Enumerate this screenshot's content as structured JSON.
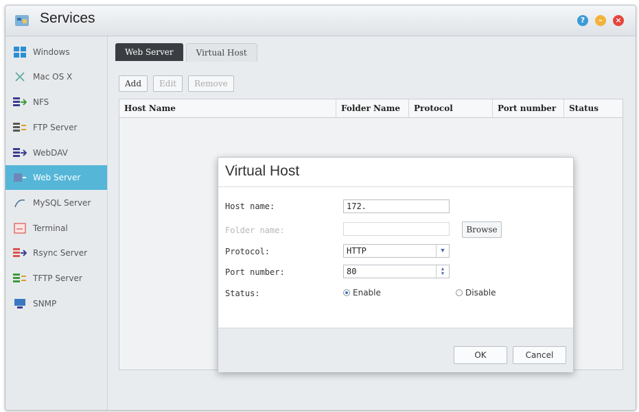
{
  "window": {
    "title": "Services"
  },
  "sidebar": {
    "items": [
      {
        "label": "Windows",
        "icon": "windows-icon"
      },
      {
        "label": "Mac OS X",
        "icon": "mac-x-icon"
      },
      {
        "label": "NFS",
        "icon": "nfs-icon"
      },
      {
        "label": "FTP Server",
        "icon": "ftp-icon"
      },
      {
        "label": "WebDAV",
        "icon": "webdav-icon"
      },
      {
        "label": "Web Server",
        "icon": "web-server-icon",
        "active": true
      },
      {
        "label": "MySQL Server",
        "icon": "mysql-icon"
      },
      {
        "label": "Terminal",
        "icon": "terminal-icon"
      },
      {
        "label": "Rsync Server",
        "icon": "rsync-icon"
      },
      {
        "label": "TFTP Server",
        "icon": "tftp-icon"
      },
      {
        "label": "SNMP",
        "icon": "snmp-icon"
      }
    ]
  },
  "tabs": [
    {
      "label": "Web Server",
      "active": true
    },
    {
      "label": "Virtual Host",
      "active": false
    }
  ],
  "toolbar": {
    "add": "Add",
    "edit": "Edit",
    "remove": "Remove"
  },
  "table": {
    "columns": [
      "Host Name",
      "Folder Name",
      "Protocol",
      "Port number",
      "Status"
    ],
    "rows": []
  },
  "dialog": {
    "title": "Virtual Host",
    "host_label": "Host name:",
    "host_value": "172.",
    "folder_label": "Folder name:",
    "folder_value": "",
    "browse": "Browse",
    "protocol_label": "Protocol:",
    "protocol_value": "HTTP",
    "port_label": "Port number:",
    "port_value": "80",
    "status_label": "Status:",
    "enable": "Enable",
    "disable": "Disable",
    "status_selected": "Enable",
    "ok": "OK",
    "cancel": "Cancel"
  },
  "colors": {
    "accent": "#55b6d8",
    "tab_active": "#3a3d42",
    "close": "#e5453f",
    "minimize": "#f3b23a",
    "help": "#3b9bd6"
  }
}
